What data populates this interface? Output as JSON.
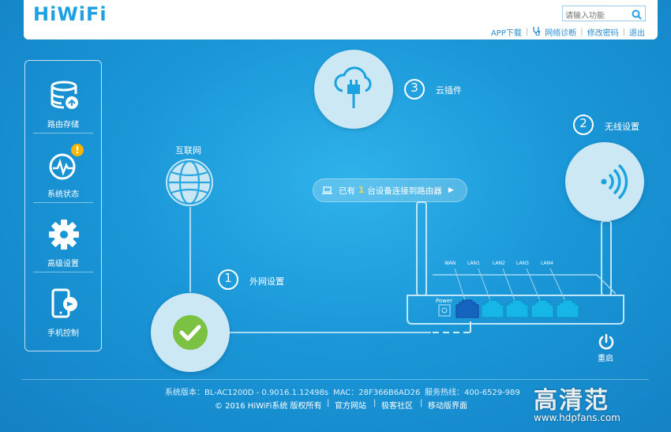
{
  "header": {
    "logo": "HiWiFi",
    "search_placeholder": "请输入功能",
    "nav": {
      "app_download": "APP下载",
      "network_diagnosis": "网络诊断",
      "change_password": "修改密码",
      "logout": "退出",
      "separator": "|"
    }
  },
  "sidebar": {
    "items": [
      {
        "label": "路由存储",
        "icon": "storage-icon"
      },
      {
        "label": "系统状态",
        "icon": "system-status-icon",
        "badge": "!"
      },
      {
        "label": "高级设置",
        "icon": "gear-icon"
      },
      {
        "label": "手机控制",
        "icon": "phone-control-icon"
      }
    ]
  },
  "diagram": {
    "internet_label": "互联网",
    "step1": {
      "num": "1",
      "label": "外网设置"
    },
    "step2": {
      "num": "2",
      "label": "无线设置"
    },
    "step3": {
      "num": "3",
      "label": "云插件"
    },
    "devices": {
      "prefix": "已有",
      "count": "1",
      "suffix": "台设备连接到路由器"
    },
    "router": {
      "power_label": "Power",
      "ports": [
        "WAN",
        "LAN1",
        "LAN2",
        "LAN3",
        "LAN4"
      ]
    },
    "restart_label": "重启"
  },
  "footer": {
    "line1": {
      "version": "系统版本：BL-AC1200D - 0.9016.1.12498s",
      "mac": "MAC：28F366B6AD26",
      "hotline": "服务热线：400-6529-989"
    },
    "line2": {
      "copyright": "© 2016 HiWiFi系统 版权所有",
      "official_site": "官方网站",
      "community": "极客社区",
      "mobile": "移动版界面",
      "separator": "|"
    }
  },
  "watermark": {
    "title": "高清范",
    "url": "www.hdpfans.com"
  },
  "colors": {
    "accent": "#1fa0e0",
    "ok_green": "#7cc242",
    "lan_port": "#16b6e8",
    "wan_port": "#1565c0",
    "badge": "#f8b400"
  }
}
